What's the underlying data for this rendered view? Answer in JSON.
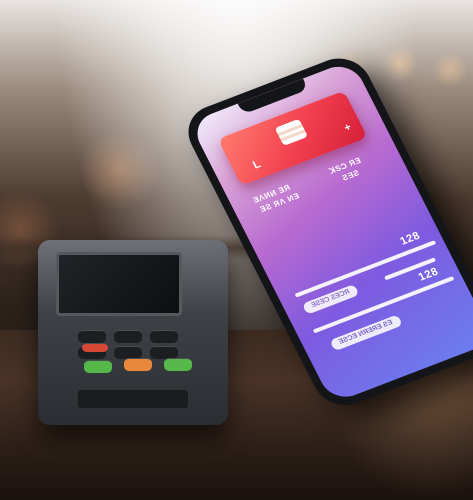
{
  "phone": {
    "card": {
      "letter": "L",
      "plus": "+"
    },
    "label_left": "ƎΛИИ ƎЯ",
    "label_left_2": "ƎƧ ЯɅ ИƎ",
    "label_right": "ꓘЅƆ ЯƎ",
    "label_right_2": "ƧƎƧ",
    "amount_top": "128",
    "amount_mid": "128",
    "line_text": "ƎƧƎƆ ƧƎƆЯ",
    "button_text": "ƎƧƆƎ ИЯƎЯƎ ƧƎ"
  },
  "colors": {
    "card": "#f23f4e",
    "screen_top": "#f2efff",
    "screen_bottom": "#6a7ff0",
    "terminal_red_key": "#d64735",
    "terminal_orange_key": "#e9873a",
    "terminal_green_key": "#56b84b"
  }
}
